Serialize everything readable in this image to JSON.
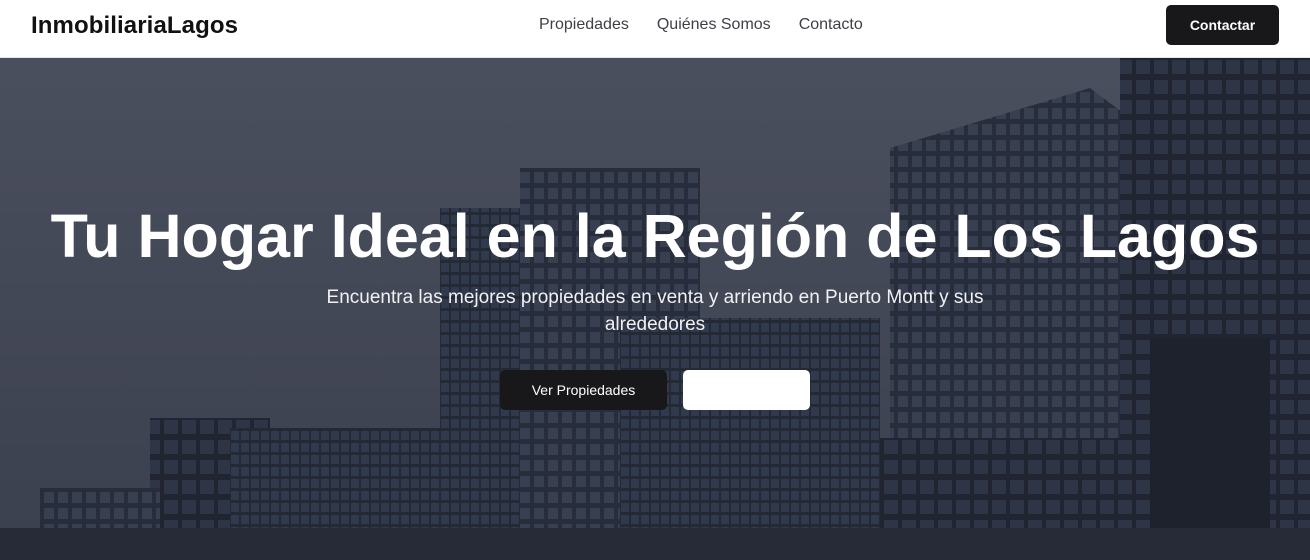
{
  "navbar": {
    "brand": "InmobiliariaLagos",
    "links": [
      "Propiedades",
      "Quiénes Somos",
      "Contacto"
    ],
    "cta_label": "Contactar"
  },
  "hero": {
    "title": "Tu Hogar Ideal en la Región de Los Lagos",
    "subtitle": "Encuentra las mejores propiedades en venta y arriendo en Puerto Montt y sus alrededores",
    "primary_button": "Ver Propiedades",
    "secondary_button": ""
  },
  "colors": {
    "primary_dark": "#18181b",
    "nav_text": "#3f3f46",
    "hero_overlay": "#232632"
  }
}
